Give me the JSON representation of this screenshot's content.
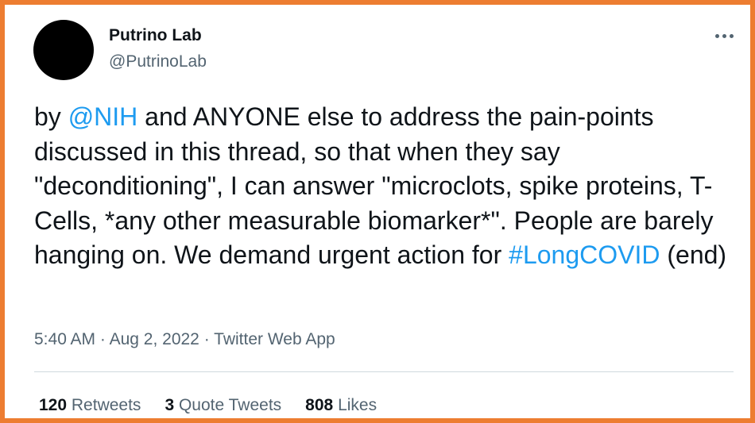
{
  "author": {
    "name": "Putrino Lab",
    "handle": "@PutrinoLab",
    "avatar_color": "#000000"
  },
  "tweet": {
    "segments": [
      {
        "type": "text",
        "text": "by "
      },
      {
        "type": "mention",
        "text": "@NIH"
      },
      {
        "type": "text",
        "text": " and ANYONE else to address the pain-points discussed in this thread, so that when they say \"deconditioning\", I can answer \"microclots, spike proteins, T-Cells, *any other measurable biomarker*\". People are barely hanging on. We demand urgent action for "
      },
      {
        "type": "hashtag",
        "text": "#LongCOVID"
      },
      {
        "type": "text",
        "text": " (end)"
      }
    ]
  },
  "meta": {
    "time": "5:40 AM",
    "separator": "·",
    "date": "Aug 2, 2022",
    "source": "Twitter Web App"
  },
  "stats": {
    "retweets_count": "120",
    "retweets_label": "Retweets",
    "quotes_count": "3",
    "quotes_label": "Quote Tweets",
    "likes_count": "808",
    "likes_label": "Likes"
  },
  "icons": {
    "more": "more-options-icon"
  },
  "colors": {
    "frame": "#ED7D31",
    "link": "#1d9bf0",
    "text": "#0f1419",
    "secondary": "#536471",
    "divider": "#cfd9de"
  }
}
